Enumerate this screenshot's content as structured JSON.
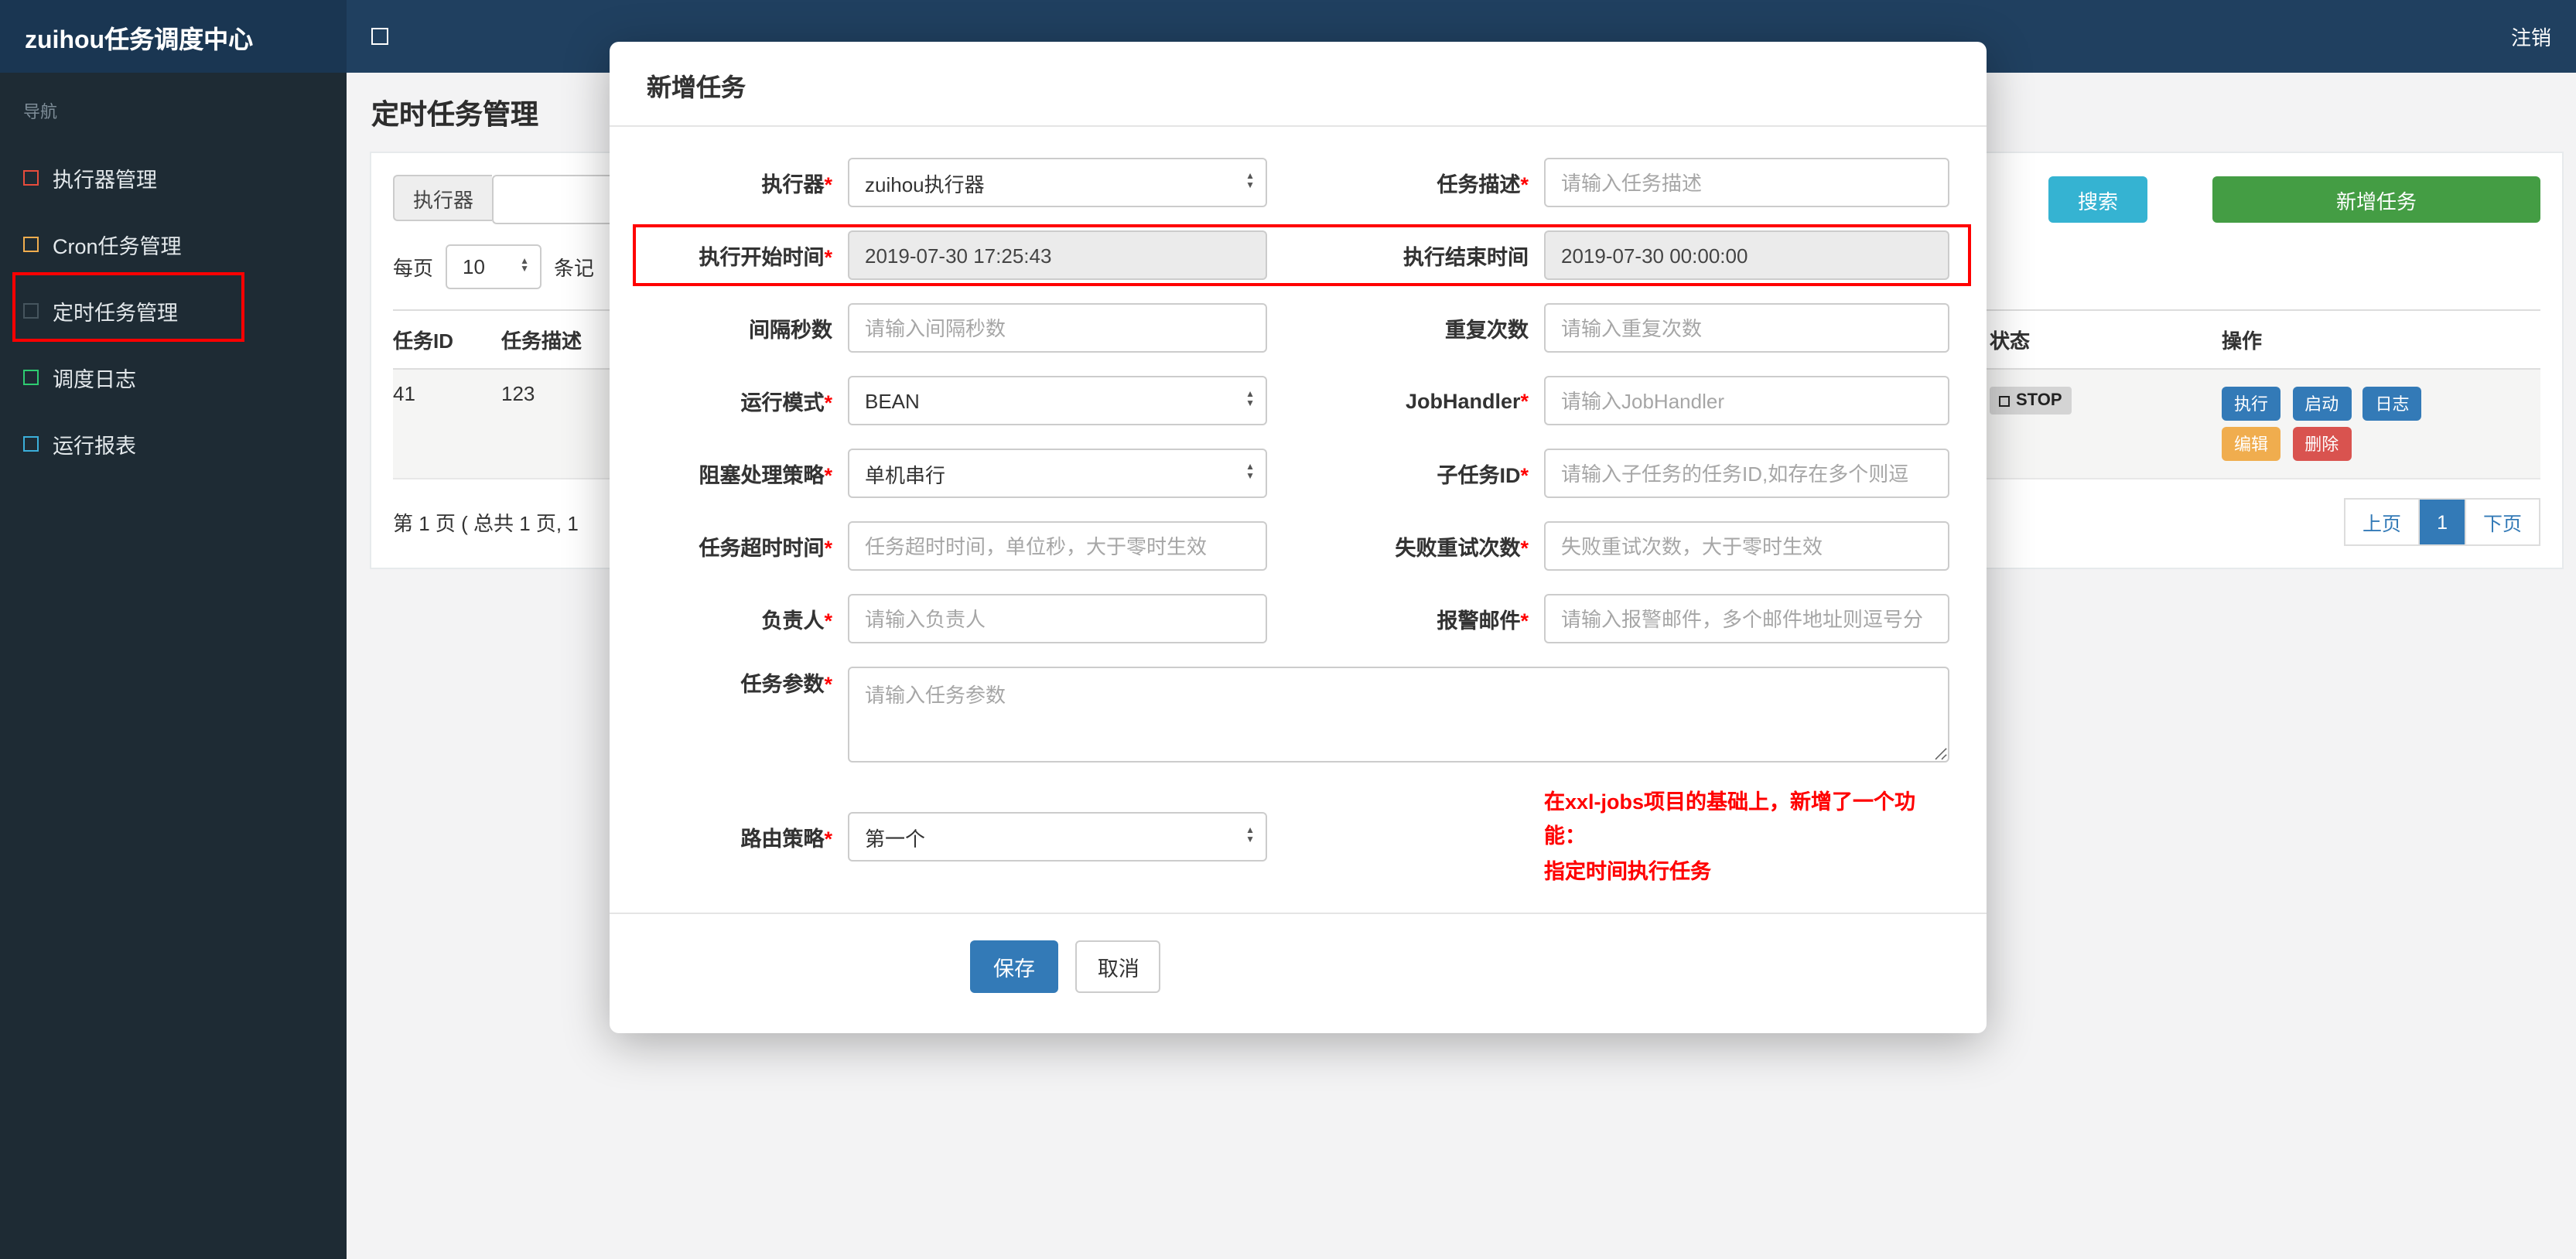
{
  "colors": {
    "info": "#35b3d2",
    "success": "#449d44",
    "primary": "#337ab7",
    "warning": "#f0ad4e",
    "danger": "#d9534f",
    "annotation": "#ff0000",
    "note_red": "#ff0000",
    "status_badge_bg": "#d4d4d4"
  },
  "topbar": {
    "brand": "zuihou任务调度中心",
    "logout": "注销"
  },
  "sidebar": {
    "nav_label": "导航",
    "items": [
      {
        "label": "执行器管理",
        "icon_color": "#e74c3c"
      },
      {
        "label": "Cron任务管理",
        "icon_color": "#f0ad4e"
      },
      {
        "label": "定时任务管理",
        "icon_color": "#46555e"
      },
      {
        "label": "调度日志",
        "icon_color": "#2ecc71"
      },
      {
        "label": "运行报表",
        "icon_color": "#3bafda"
      }
    ]
  },
  "page": {
    "title": "定时任务管理",
    "filter": {
      "executor_label": "执行器",
      "search_button": "搜索",
      "add_button": "新增任务"
    },
    "per_page": {
      "prefix": "每页",
      "value": "10",
      "suffix": "条记"
    },
    "table": {
      "headers": [
        "任务ID",
        "任务描述",
        "状态",
        "操作"
      ],
      "row": {
        "job_id": "41",
        "job_desc": "123",
        "status": "STOP",
        "ops": [
          "执行",
          "启动",
          "日志",
          "编辑",
          "删除"
        ]
      }
    },
    "pagination": {
      "summary": "第 1 页 ( 总共 1 页, 1",
      "prev": "上页",
      "current": "1",
      "next": "下页"
    }
  },
  "modal": {
    "title": "新增任务",
    "required_mark": "*",
    "fields": {
      "executor": {
        "label": "执行器",
        "value": "zuihou执行器"
      },
      "job_desc": {
        "label": "任务描述",
        "placeholder": "请输入任务描述"
      },
      "start_time": {
        "label": "执行开始时间",
        "value": "2019-07-30 17:25:43"
      },
      "end_time": {
        "label": "执行结束时间",
        "value": "2019-07-30 00:00:00"
      },
      "interval": {
        "label": "间隔秒数",
        "placeholder": "请输入间隔秒数"
      },
      "repeat": {
        "label": "重复次数",
        "placeholder": "请输入重复次数"
      },
      "run_mode": {
        "label": "运行模式",
        "value": "BEAN"
      },
      "job_handler": {
        "label": "JobHandler",
        "placeholder": "请输入JobHandler"
      },
      "block_strategy": {
        "label": "阻塞处理策略",
        "value": "单机串行"
      },
      "child_job": {
        "label": "子任务ID",
        "placeholder": "请输入子任务的任务ID,如存在多个则逗"
      },
      "timeout": {
        "label": "任务超时时间",
        "placeholder": "任务超时时间，单位秒，大于零时生效"
      },
      "fail_retry": {
        "label": "失败重试次数",
        "placeholder": "失败重试次数，大于零时生效"
      },
      "owner": {
        "label": "负责人",
        "placeholder": "请输入负责人"
      },
      "alarm_email": {
        "label": "报警邮件",
        "placeholder": "请输入报警邮件，多个邮件地址则逗号分"
      },
      "job_param": {
        "label": "任务参数",
        "placeholder": "请输入任务参数"
      },
      "route_strategy": {
        "label": "路由策略",
        "value": "第一个"
      }
    },
    "note_line1": "在xxl-jobs项目的基础上，新增了一个功能：",
    "note_line2": "指定时间执行任务",
    "save_button": "保存",
    "cancel_button": "取消"
  }
}
